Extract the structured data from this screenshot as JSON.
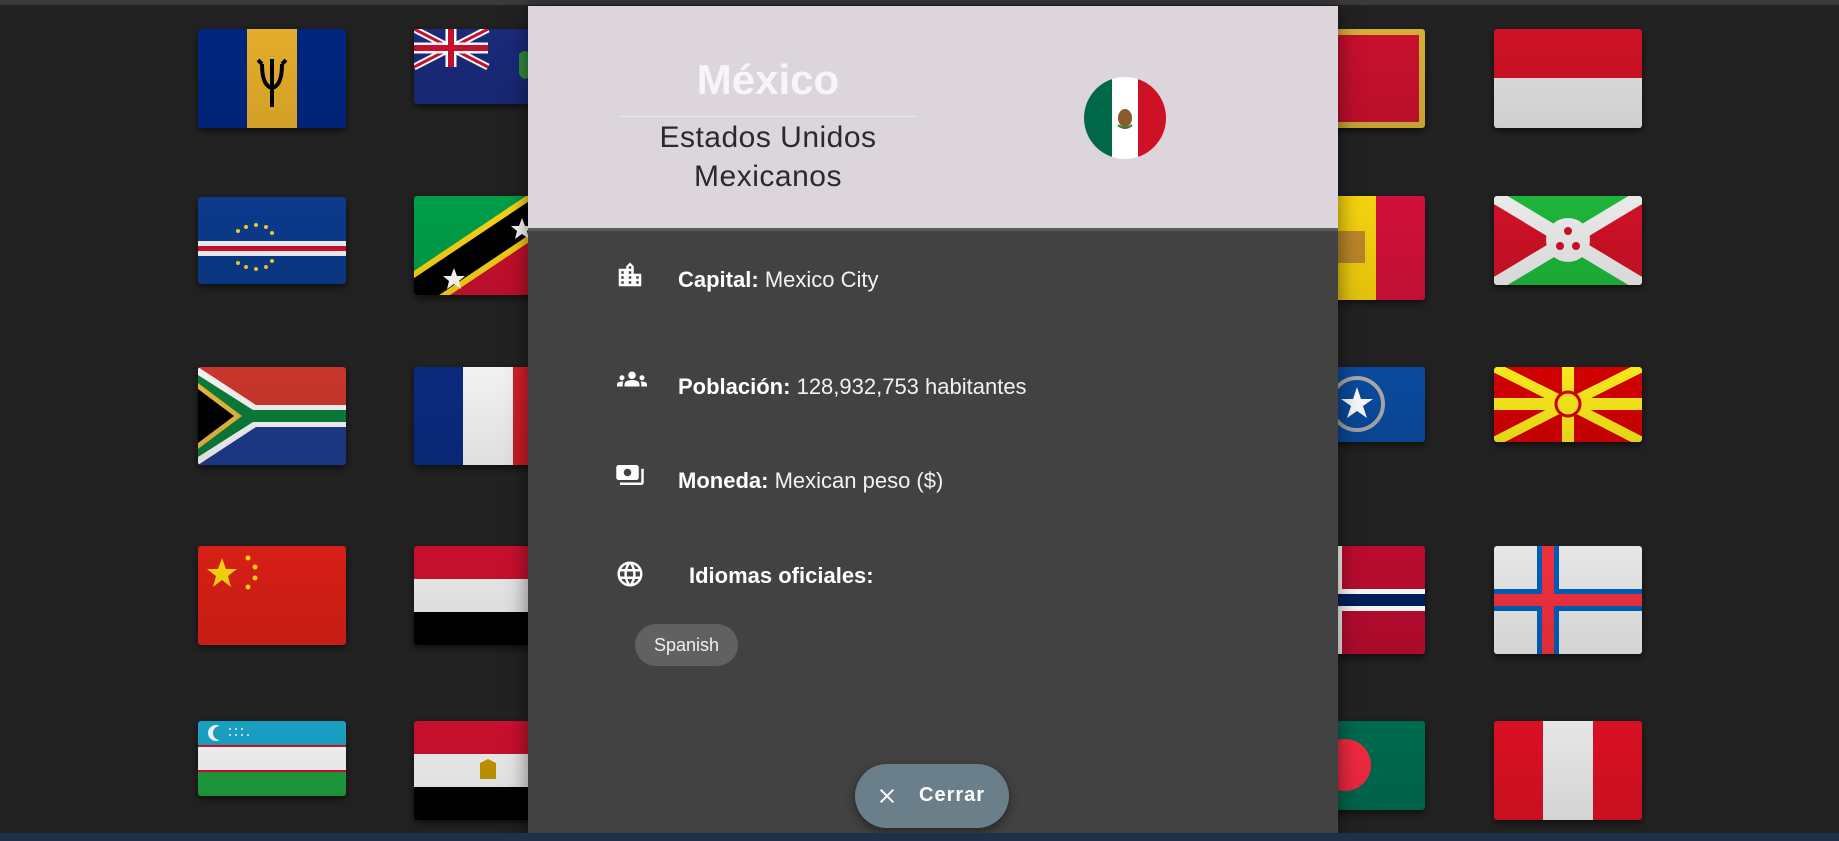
{
  "modal": {
    "common_name": "México",
    "official_name": "Estados Unidos Mexicanos",
    "flag_icon": "mexico-flag-icon",
    "rows": {
      "capital": {
        "label": "Capital:",
        "value": "Mexico City",
        "icon": "city-icon"
      },
      "population": {
        "label": "Población:",
        "value": "128,932,753 habitantes",
        "icon": "people-icon"
      },
      "currency": {
        "label": "Moneda:",
        "value": "Mexican peso ($)",
        "icon": "money-icon"
      },
      "languages": {
        "label": "Idiomas oficiales:",
        "icon": "globe-icon",
        "items": [
          "Spanish"
        ]
      }
    },
    "close_label": "Cerrar"
  },
  "background_flags": [
    "Barbados",
    "Pitcairn Islands",
    "Cape Verde",
    "Saint Kitts and Nevis",
    "South Africa",
    "France",
    "China",
    "Yemen",
    "Uzbekistan",
    "Egypt",
    "Montenegro",
    "Monaco",
    "Andorra",
    "Burundi",
    "Northern Mariana Islands",
    "North Macedonia",
    "Norway",
    "Faroe Islands",
    "Bangladesh",
    "Peru"
  ]
}
